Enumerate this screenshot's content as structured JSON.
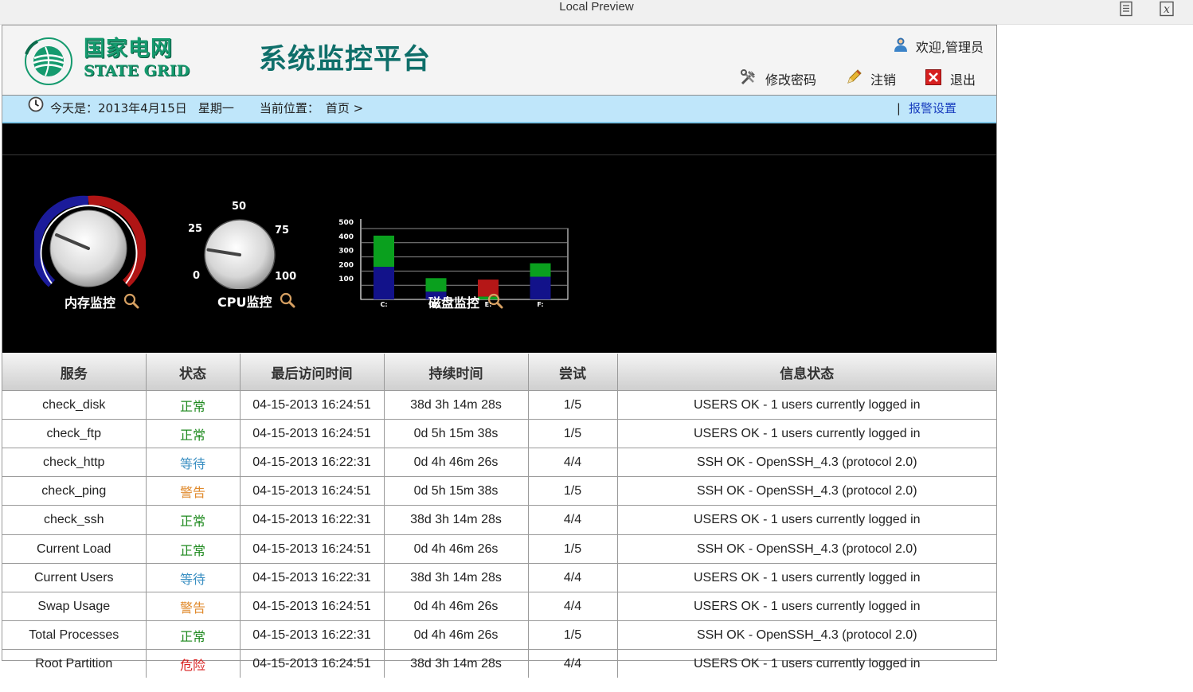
{
  "window": {
    "title": "Local Preview",
    "doc_icon": "document-icon",
    "close_icon": "close-x-icon"
  },
  "header": {
    "logo_cn": "国家电网",
    "logo_en": "STATE GRID",
    "app_title": "系统监控平台",
    "welcome": "欢迎,管理员",
    "links": [
      {
        "label": "修改密码",
        "icon": "tools-icon"
      },
      {
        "label": "注销",
        "icon": "pencil-icon"
      },
      {
        "label": "退出",
        "icon": "exit-icon"
      }
    ]
  },
  "nav": {
    "date_label": "今天是：2013年4月15日",
    "weekday": "星期一",
    "position_label": "当前位置：",
    "position_value": "首页 >",
    "separator": "|",
    "alarm_link": "报警设置"
  },
  "monitors": {
    "memory": {
      "label": "内存监控"
    },
    "cpu": {
      "label": "CPU监控",
      "ticks": [
        "0",
        "25",
        "50",
        "75",
        "100"
      ],
      "value": 20
    },
    "disk": {
      "label": "磁盘监控"
    }
  },
  "chart_data": {
    "type": "bar",
    "categories": [
      "C:",
      "D:",
      "E:",
      "F:"
    ],
    "y_ticks": [
      "100",
      "200",
      "300",
      "400",
      "500"
    ],
    "ylim": [
      0,
      500
    ],
    "grid": true,
    "stacked": true,
    "series": [
      {
        "color": "#12128a",
        "values": [
          230,
          55,
          0,
          160
        ]
      },
      {
        "color": "#0aa01e",
        "values": [
          220,
          95,
          20,
          95
        ]
      },
      {
        "color": "#b51717",
        "values": [
          0,
          0,
          120,
          0
        ]
      }
    ]
  },
  "table": {
    "headers": [
      "服务",
      "状态",
      "最后访问时间",
      "持续时间",
      "尝试",
      "信息状态"
    ],
    "status_colors": {
      "正常": "#1f8a1f",
      "等待": "#3a8fc2",
      "警告": "#e08a2c",
      "危险": "#d81f1f"
    },
    "rows": [
      [
        "check_disk",
        "正常",
        "04-15-2013 16:24:51",
        "38d 3h 14m 28s",
        "1/5",
        "USERS OK - 1 users currently logged in"
      ],
      [
        "check_ftp",
        "正常",
        "04-15-2013 16:24:51",
        "0d 5h 15m 38s",
        "1/5",
        "USERS OK - 1 users currently logged in"
      ],
      [
        "check_http",
        "等待",
        "04-15-2013 16:22:31",
        "0d 4h 46m 26s",
        "4/4",
        "SSH OK - OpenSSH_4.3 (protocol 2.0)"
      ],
      [
        "check_ping",
        "警告",
        "04-15-2013 16:24:51",
        "0d 5h 15m 38s",
        "1/5",
        "SSH OK - OpenSSH_4.3 (protocol 2.0)"
      ],
      [
        "check_ssh",
        "正常",
        "04-15-2013 16:22:31",
        "38d 3h 14m 28s",
        "4/4",
        "USERS OK - 1 users currently logged in"
      ],
      [
        "Current Load",
        "正常",
        "04-15-2013 16:24:51",
        "0d 4h 46m 26s",
        "1/5",
        "SSH OK - OpenSSH_4.3 (protocol 2.0)"
      ],
      [
        "Current Users",
        "等待",
        "04-15-2013 16:22:31",
        "38d 3h 14m 28s",
        "4/4",
        "USERS OK - 1 users currently logged in"
      ],
      [
        "Swap Usage",
        "警告",
        "04-15-2013 16:24:51",
        "0d 4h 46m 26s",
        "4/4",
        "USERS OK - 1 users currently logged in"
      ],
      [
        "Total Processes",
        "正常",
        "04-15-2013 16:22:31",
        "0d 4h 46m 26s",
        "1/5",
        "SSH OK - OpenSSH_4.3 (protocol 2.0)"
      ],
      [
        "Root Partition",
        "危险",
        "04-15-2013 16:24:51",
        "38d 3h 14m 28s",
        "4/4",
        "USERS OK - 1 users currently logged in"
      ]
    ]
  }
}
